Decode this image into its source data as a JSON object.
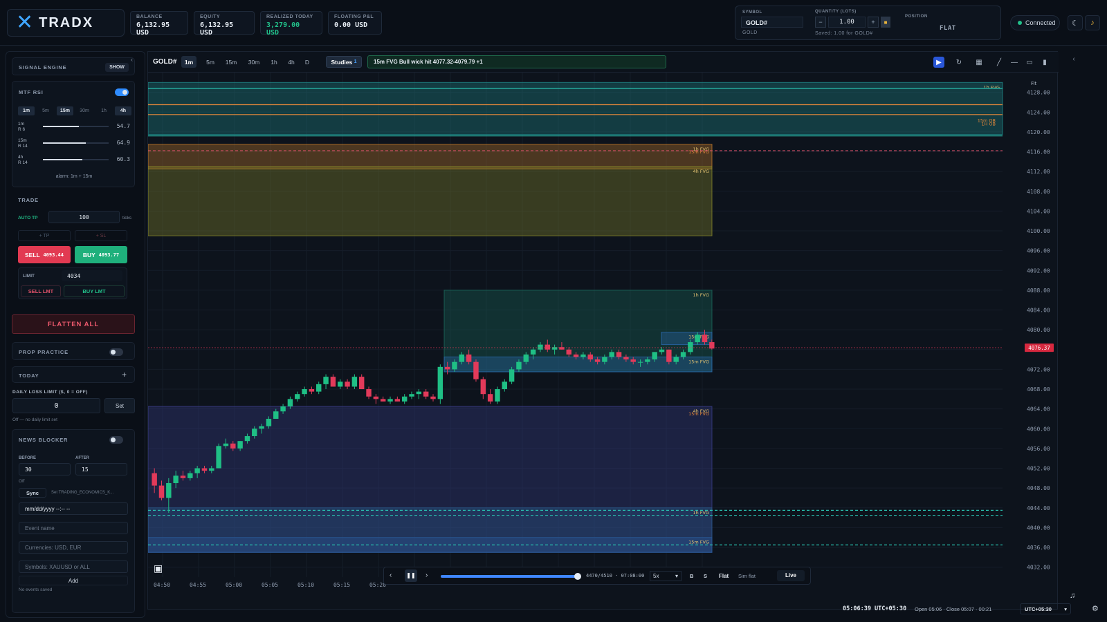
{
  "app": {
    "brand": "TRADX"
  },
  "stats": [
    {
      "label": "BALANCE",
      "value": "6,132.95 USD"
    },
    {
      "label": "EQUITY",
      "value": "6,132.95 USD"
    },
    {
      "label": "REALIZED TODAY",
      "value": "3,279.00 USD"
    },
    {
      "label": "FLOATING P&L",
      "value": "0.00 USD"
    }
  ],
  "order": {
    "symbol_label": "SYMBOL",
    "symbol": "GOLD#",
    "symbol_sub": "GOLD",
    "qty_label": "QUANTITY (LOTS)",
    "qty": "1.00",
    "saved": "Saved: 1.00 for GOLD#",
    "position_label": "POSITION",
    "position": "FLAT"
  },
  "status": {
    "connection": "Connected"
  },
  "sidebar": {
    "signal_engine": {
      "title": "SIGNAL ENGINE",
      "show": "SHOW"
    },
    "mtf": {
      "title": "MTF RSI",
      "timeframes": [
        "1m",
        "5m",
        "15m",
        "30m",
        "1h",
        "4h"
      ],
      "active": [
        0,
        2,
        5
      ],
      "rows": [
        {
          "name": "1m",
          "sub": "R 6",
          "value": "54.7",
          "level": 0.547
        },
        {
          "name": "15m",
          "sub": "R 14",
          "value": "64.9",
          "level": 0.649
        },
        {
          "name": "4h",
          "sub": "R 14",
          "value": "60.3",
          "level": 0.603
        }
      ],
      "alarm": "alarm: 1m + 15m"
    },
    "trade": {
      "title": "TRADE",
      "auto_tp": "AUTO TP",
      "auto_tp_value": "100",
      "ticks": "ticks",
      "tp": "+ TP",
      "sl": "+ SL",
      "sell": "SELL",
      "sell_price": "4093.44",
      "buy": "BUY",
      "buy_price": "4093.77",
      "limit_label": "LIMIT",
      "limit_value": "4034",
      "sell_lmt": "SELL LMT",
      "buy_lmt": "BUY LMT"
    },
    "flatten": "FLATTEN ALL",
    "prop": {
      "title": "PROP PRACTICE"
    },
    "today": {
      "title": "TODAY",
      "plus": "+"
    },
    "loss": {
      "title": "DAILY LOSS LIMIT ($, 0 = OFF)",
      "value": "0",
      "set": "Set",
      "note": "Off — no daily limit set"
    },
    "news": {
      "title": "NEWS BLOCKER",
      "before_label": "BEFORE",
      "before": "30",
      "after_label": "AFTER",
      "after": "15",
      "state": "Off",
      "sync": "Sync",
      "sync_note": "Set TRADING_ECONOMICS_K...",
      "date_ph": "mm/dd/yyyy --:-- --",
      "event_ph": "Event name",
      "curr_ph": "Currencies: USD, EUR",
      "sym_ph": "Symbols: XAUUSD or ALL",
      "add": "Add",
      "empty": "No events saved"
    }
  },
  "chart_toolbar": {
    "symbol": "GOLD#",
    "timeframes": [
      "1m",
      "5m",
      "15m",
      "30m",
      "1h",
      "4h",
      "D"
    ],
    "active_tf": "1m",
    "studies": "Studies",
    "studies_count": "1",
    "alert": "15m FVG Bull wick hit 4077.32-4079.79 +1",
    "fit": "Fit"
  },
  "chart_data": {
    "type": "candlestick",
    "price_range": [
      4030,
      4132
    ],
    "y_ticks": [
      "4128.00",
      "4124.00",
      "4120.00",
      "4116.00",
      "4112.00",
      "4108.00",
      "4104.00",
      "4100.00",
      "4096.00",
      "4092.00",
      "4088.00",
      "4084.00",
      "4080.00",
      "4076.00",
      "4072.00",
      "4068.00",
      "4064.00",
      "4060.00",
      "4056.00",
      "4052.00",
      "4048.00",
      "4044.00",
      "4040.00",
      "4036.00",
      "4032.00"
    ],
    "x_ticks": [
      "04:50",
      "04:55",
      "05:00",
      "05:05",
      "05:10",
      "05:15",
      "05:20"
    ],
    "last_price": "4076.37",
    "last_price_value": 4076.37,
    "candles": [
      [
        4051,
        4052,
        4047,
        4048.5
      ],
      [
        4048.5,
        4049.5,
        4045.5,
        4046
      ],
      [
        4046,
        4050,
        4043,
        4049
      ],
      [
        4049,
        4051.5,
        4048,
        4050.5
      ],
      [
        4050.5,
        4051.5,
        4049.5,
        4050
      ],
      [
        4050,
        4051.5,
        4049.5,
        4051
      ],
      [
        4051,
        4052.5,
        4050,
        4052
      ],
      [
        4052,
        4052.5,
        4051,
        4051.5
      ],
      [
        4051.5,
        4052.5,
        4051,
        4052
      ],
      [
        4052,
        4057,
        4052,
        4056.5
      ],
      [
        4056.5,
        4058,
        4056,
        4057
      ],
      [
        4057,
        4057.5,
        4055.5,
        4056
      ],
      [
        4056,
        4057.5,
        4055.5,
        4057.5
      ],
      [
        4057.5,
        4059,
        4057,
        4058.5
      ],
      [
        4058.5,
        4060.5,
        4058,
        4060
      ],
      [
        4060,
        4061,
        4059,
        4060.5
      ],
      [
        4060.5,
        4062.5,
        4060,
        4062
      ],
      [
        4062,
        4064,
        4062,
        4063.5
      ],
      [
        4063.5,
        4065,
        4063,
        4064.5
      ],
      [
        4064.5,
        4066.5,
        4064,
        4066
      ],
      [
        4066,
        4067.5,
        4065.5,
        4067
      ],
      [
        4067,
        4068.5,
        4066.5,
        4068
      ],
      [
        4068,
        4068.5,
        4067,
        4067.5
      ],
      [
        4067.5,
        4069.5,
        4067,
        4069
      ],
      [
        4069,
        4071,
        4068,
        4070.5
      ],
      [
        4070.5,
        4071,
        4068.5,
        4068.5
      ],
      [
        4068.5,
        4070,
        4068,
        4069.5
      ],
      [
        4069.5,
        4070,
        4068,
        4068.5
      ],
      [
        4068.5,
        4071,
        4068,
        4070.5
      ],
      [
        4070.5,
        4071,
        4068,
        4068
      ],
      [
        4068,
        4068.5,
        4066,
        4066.5
      ],
      [
        4066.5,
        4067,
        4065,
        4066
      ],
      [
        4066,
        4066.5,
        4065.5,
        4065.5
      ],
      [
        4065.5,
        4066.5,
        4065,
        4066
      ],
      [
        4066,
        4066.5,
        4065.5,
        4065.5
      ],
      [
        4065.5,
        4067,
        4065,
        4066.5
      ],
      [
        4066.5,
        4067.5,
        4066,
        4067
      ],
      [
        4067,
        4068,
        4066,
        4067.5
      ],
      [
        4067.5,
        4068,
        4066,
        4066.5
      ],
      [
        4066.5,
        4067,
        4065.5,
        4066
      ],
      [
        4066,
        4073,
        4065,
        4072.5
      ],
      [
        4072.5,
        4073.5,
        4071,
        4072
      ],
      [
        4072,
        4074,
        4071.5,
        4073.5
      ],
      [
        4073.5,
        4075.5,
        4073,
        4075
      ],
      [
        4075,
        4076,
        4073,
        4073.5
      ],
      [
        4073.5,
        4074,
        4069.5,
        4070
      ],
      [
        4070,
        4070.5,
        4066,
        4067
      ],
      [
        4067,
        4068,
        4065,
        4065.5
      ],
      [
        4065.5,
        4068.5,
        4065,
        4068
      ],
      [
        4068,
        4070,
        4067.5,
        4069.5
      ],
      [
        4069.5,
        4072.5,
        4069,
        4072
      ],
      [
        4072,
        4074,
        4071.5,
        4073.5
      ],
      [
        4073.5,
        4075.5,
        4073,
        4075
      ],
      [
        4075,
        4076.5,
        4074,
        4076
      ],
      [
        4076,
        4077.5,
        4075.5,
        4077
      ],
      [
        4077,
        4078,
        4075.5,
        4076
      ],
      [
        4076,
        4077,
        4075,
        4076.5
      ],
      [
        4076.5,
        4077.5,
        4076,
        4076
      ],
      [
        4076,
        4076.5,
        4074.5,
        4075
      ],
      [
        4075,
        4075.5,
        4074,
        4074.5
      ],
      [
        4074.5,
        4075.5,
        4074,
        4075
      ],
      [
        4075,
        4075.5,
        4073.5,
        4074
      ],
      [
        4074,
        4074.5,
        4073,
        4073.5
      ],
      [
        4073.5,
        4075,
        4073,
        4074.5
      ],
      [
        4074.5,
        4076,
        4074,
        4075.5
      ],
      [
        4075.5,
        4076,
        4074,
        4074.5
      ],
      [
        4074.5,
        4075,
        4073.5,
        4074
      ],
      [
        4074,
        4074.5,
        4073,
        4073.5
      ],
      [
        4073.5,
        4074,
        4072.5,
        4073.5
      ],
      [
        4073.5,
        4074.5,
        4073,
        4074
      ],
      [
        4074,
        4075.5,
        4073.5,
        4075.5
      ],
      [
        4075.5,
        4076.5,
        4075,
        4076
      ],
      [
        4076,
        4076,
        4073,
        4073.5
      ],
      [
        4073.5,
        4075,
        4073,
        4074.5
      ],
      [
        4074.5,
        4076,
        4074,
        4075.5
      ],
      [
        4075.5,
        4078,
        4075,
        4077.5
      ],
      [
        4077.5,
        4079.5,
        4077,
        4079
      ],
      [
        4079,
        4080,
        4077,
        4077.5
      ],
      [
        4077.5,
        4078,
        4076,
        4076.2
      ]
    ],
    "zones": [
      {
        "label": "1h FVG",
        "label2": "15m OB",
        "label3": "1H OB",
        "top": 4130,
        "bottom": 4119.5,
        "color": "#1f8a8a",
        "x_end": "full"
      },
      {
        "label": "1h FVG",
        "label2": "15m FVG",
        "top": 4117.5,
        "bottom": 4112.5,
        "color": "#c27a2a",
        "x_end": "cut"
      },
      {
        "label": "4h FVG",
        "top": 4113,
        "bottom": 4099,
        "color": "#8a8a2a",
        "x_end": "cut"
      },
      {
        "label": "1h FVG",
        "top": 4088,
        "bottom": 4071.5,
        "color": "#1b6a5c",
        "x_start": "mid",
        "x_end": "cut"
      },
      {
        "label": "15m FVG",
        "top": 4074.5,
        "bottom": 4071.5,
        "color": "#2a6ab0",
        "x_start": "mid",
        "x_end": "cut"
      },
      {
        "label": "15m FVG",
        "top": 4079.5,
        "bottom": 4077,
        "color": "#2a6ab0",
        "x_start": "late",
        "x_end": "cut"
      },
      {
        "label": "4h FVG",
        "label2": "15m FVG",
        "top": 4064.5,
        "bottom": 4035,
        "color": "#3a3f8a",
        "x_end": "cut"
      },
      {
        "label": "1h FVG",
        "top": 4044,
        "bottom": 4035,
        "color": "#2a5a8a",
        "x_end": "cut"
      },
      {
        "label": "15m FVG",
        "top": 4038,
        "bottom": 4035,
        "color": "#2a5a9a",
        "x_end": "cut"
      }
    ],
    "lines": [
      {
        "price": 4125.5,
        "color": "#e8893a"
      },
      {
        "price": 4123.5,
        "color": "#e8893a"
      },
      {
        "price": 4128.8,
        "color": "#29c2b0"
      },
      {
        "price": 4119.2,
        "color": "#29c2b0"
      },
      {
        "price": 4116.2,
        "color": "#e0526a",
        "dashed": true
      },
      {
        "price": 4043.5,
        "color": "#29c2b0",
        "dashed": true
      },
      {
        "price": 4042.5,
        "color": "#29c2b0",
        "dashed": true
      },
      {
        "price": 4036.5,
        "color": "#29c2b0",
        "dashed": true
      }
    ]
  },
  "replay": {
    "progress": "4470/4510 · 07:08:00",
    "progress_fraction": 0.991,
    "speed": "5x",
    "b": "B",
    "s": "S",
    "flat": "Flat",
    "sim": "Sim flat",
    "live": "Live"
  },
  "footer": {
    "clock": "05:06:39 UTC+05:30",
    "candle_info": "Open 05:06 · Close 05:07 · 00:21",
    "tz": "UTC+05:30"
  }
}
